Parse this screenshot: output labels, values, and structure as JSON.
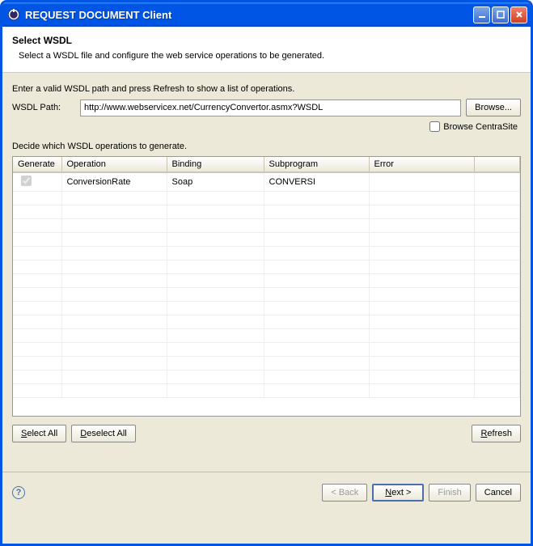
{
  "window": {
    "title": "REQUEST DOCUMENT Client"
  },
  "header": {
    "title": "Select WSDL",
    "description": "Select a WSDL file and configure the web service operations to be generated."
  },
  "form": {
    "prompt": "Enter a valid WSDL path and press Refresh to show a list of operations.",
    "path_label": "WSDL Path:",
    "path_value": "http://www.webservicex.net/CurrencyConvertor.asmx?WSDL",
    "browse_label": "Browse...",
    "centrasite_label": "Browse CentraSite",
    "table_label": "Decide which WSDL operations to generate."
  },
  "table": {
    "columns": {
      "generate": "Generate",
      "operation": "Operation",
      "binding": "Binding",
      "subprogram": "Subprogram",
      "error": "Error"
    },
    "rows": [
      {
        "generate": true,
        "operation": "ConversionRate",
        "binding": "Soap",
        "subprogram": "CONVERSI",
        "error": ""
      }
    ]
  },
  "buttons": {
    "select_all": "Select All",
    "deselect_all": "Deselect All",
    "refresh": "Refresh",
    "back": "< Back",
    "next": "Next >",
    "finish": "Finish",
    "cancel": "Cancel"
  }
}
